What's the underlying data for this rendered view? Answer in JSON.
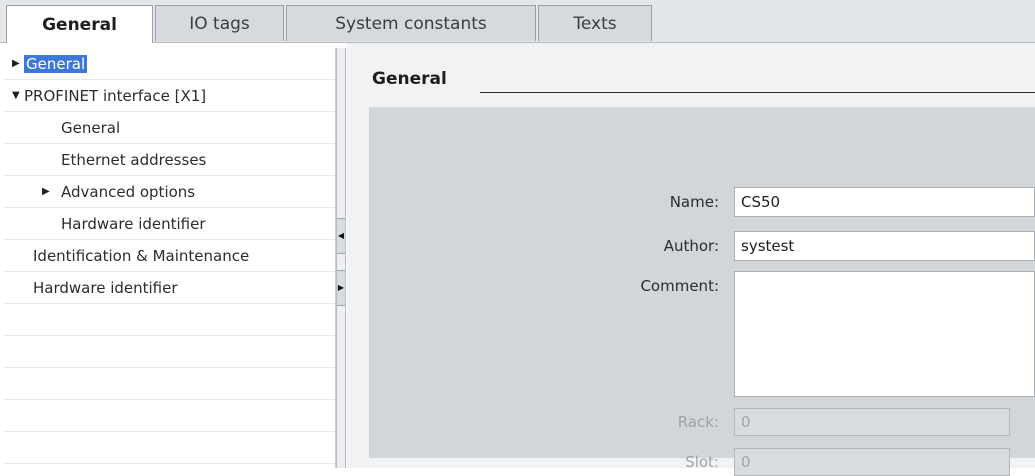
{
  "tabs": [
    {
      "label": "General",
      "active": true
    },
    {
      "label": "IO tags",
      "active": false
    },
    {
      "label": "System constants",
      "active": false
    },
    {
      "label": "Texts",
      "active": false
    }
  ],
  "tree": {
    "items": [
      {
        "label": "General",
        "arrow": "right",
        "selected": true
      },
      {
        "label": "PROFINET interface [X1]",
        "arrow": "down"
      },
      {
        "label": "General"
      },
      {
        "label": "Ethernet addresses"
      },
      {
        "label": "Advanced options",
        "arrow": "right"
      },
      {
        "label": "Hardware identifier"
      },
      {
        "label": "Identification & Maintenance"
      },
      {
        "label": "Hardware identifier"
      }
    ]
  },
  "main": {
    "section_title": "General",
    "fields": {
      "name": {
        "label": "Name:",
        "value": "CS50"
      },
      "author": {
        "label": "Author:",
        "value": "systest"
      },
      "comment": {
        "label": "Comment:",
        "value": ""
      },
      "rack": {
        "label": "Rack:",
        "value": "0"
      },
      "slot": {
        "label": "Slot:",
        "value": "0"
      }
    }
  },
  "colors": {
    "selection": "#3d78d8",
    "panel_gray": "#d2d6d9",
    "background": "#f0f2f3"
  }
}
